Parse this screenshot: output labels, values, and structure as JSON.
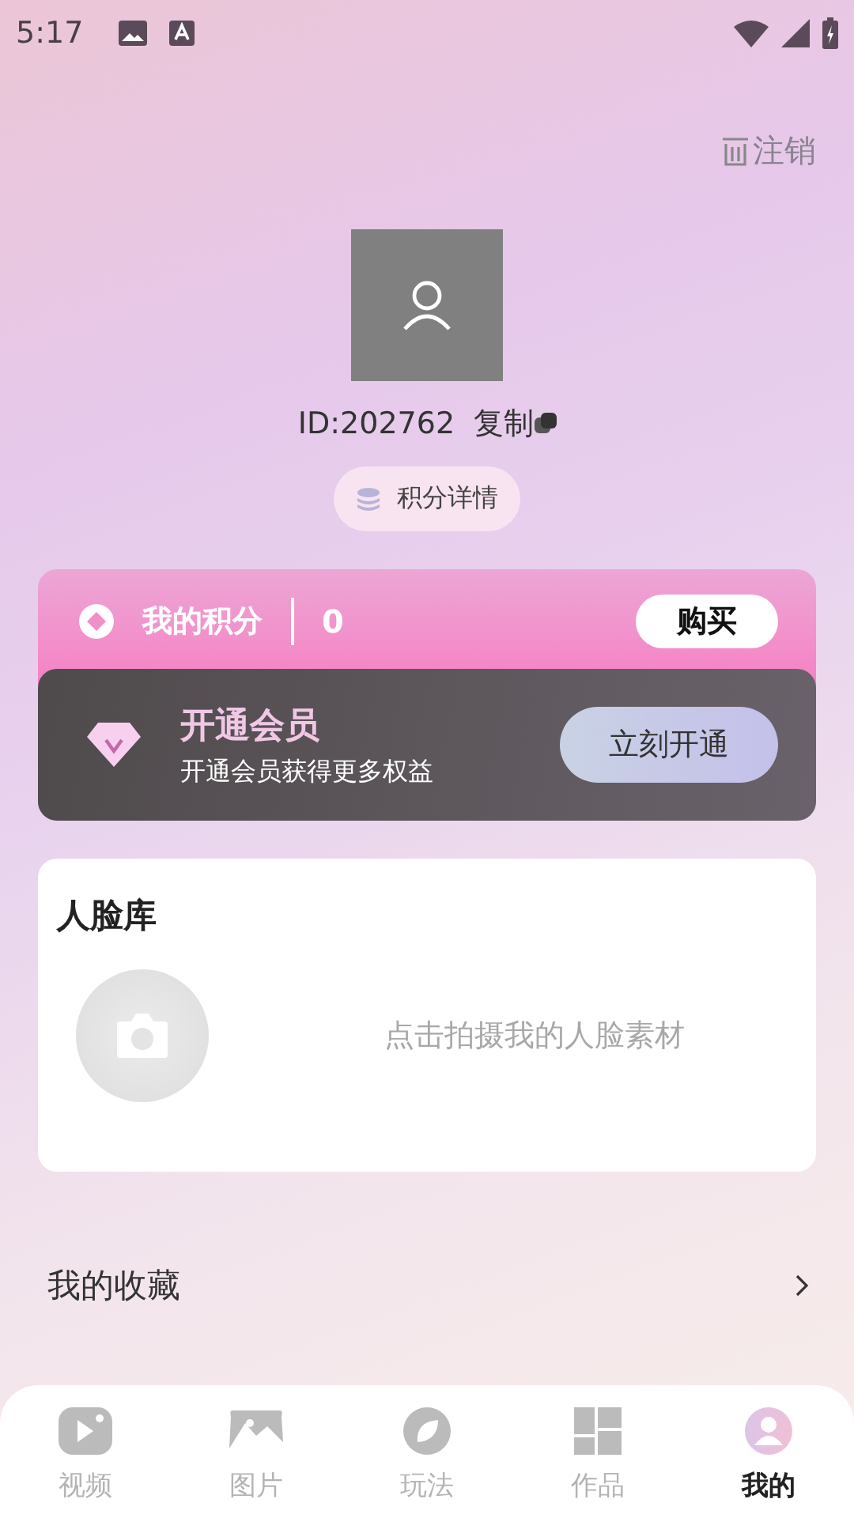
{
  "status_bar": {
    "time": "5:17"
  },
  "logout": {
    "label": "注销"
  },
  "profile": {
    "id_text": "ID:202762",
    "copy_label": "复制",
    "points_detail": "积分详情"
  },
  "points_card": {
    "title": "我的积分",
    "value": "0",
    "buy": "购买"
  },
  "vip_card": {
    "title": "开通会员",
    "subtitle": "开通会员获得更多权益",
    "button": "立刻开通"
  },
  "face_library": {
    "title": "人脸库",
    "hint": "点击拍摄我的人脸素材"
  },
  "favorites": {
    "label": "我的收藏"
  },
  "tabs": [
    {
      "kind": "video",
      "label": "视频",
      "selected": false
    },
    {
      "kind": "image",
      "label": "图片",
      "selected": false
    },
    {
      "kind": "play",
      "label": "玩法",
      "selected": false
    },
    {
      "kind": "works",
      "label": "作品",
      "selected": false
    },
    {
      "kind": "mine",
      "label": "我的",
      "selected": true
    }
  ]
}
